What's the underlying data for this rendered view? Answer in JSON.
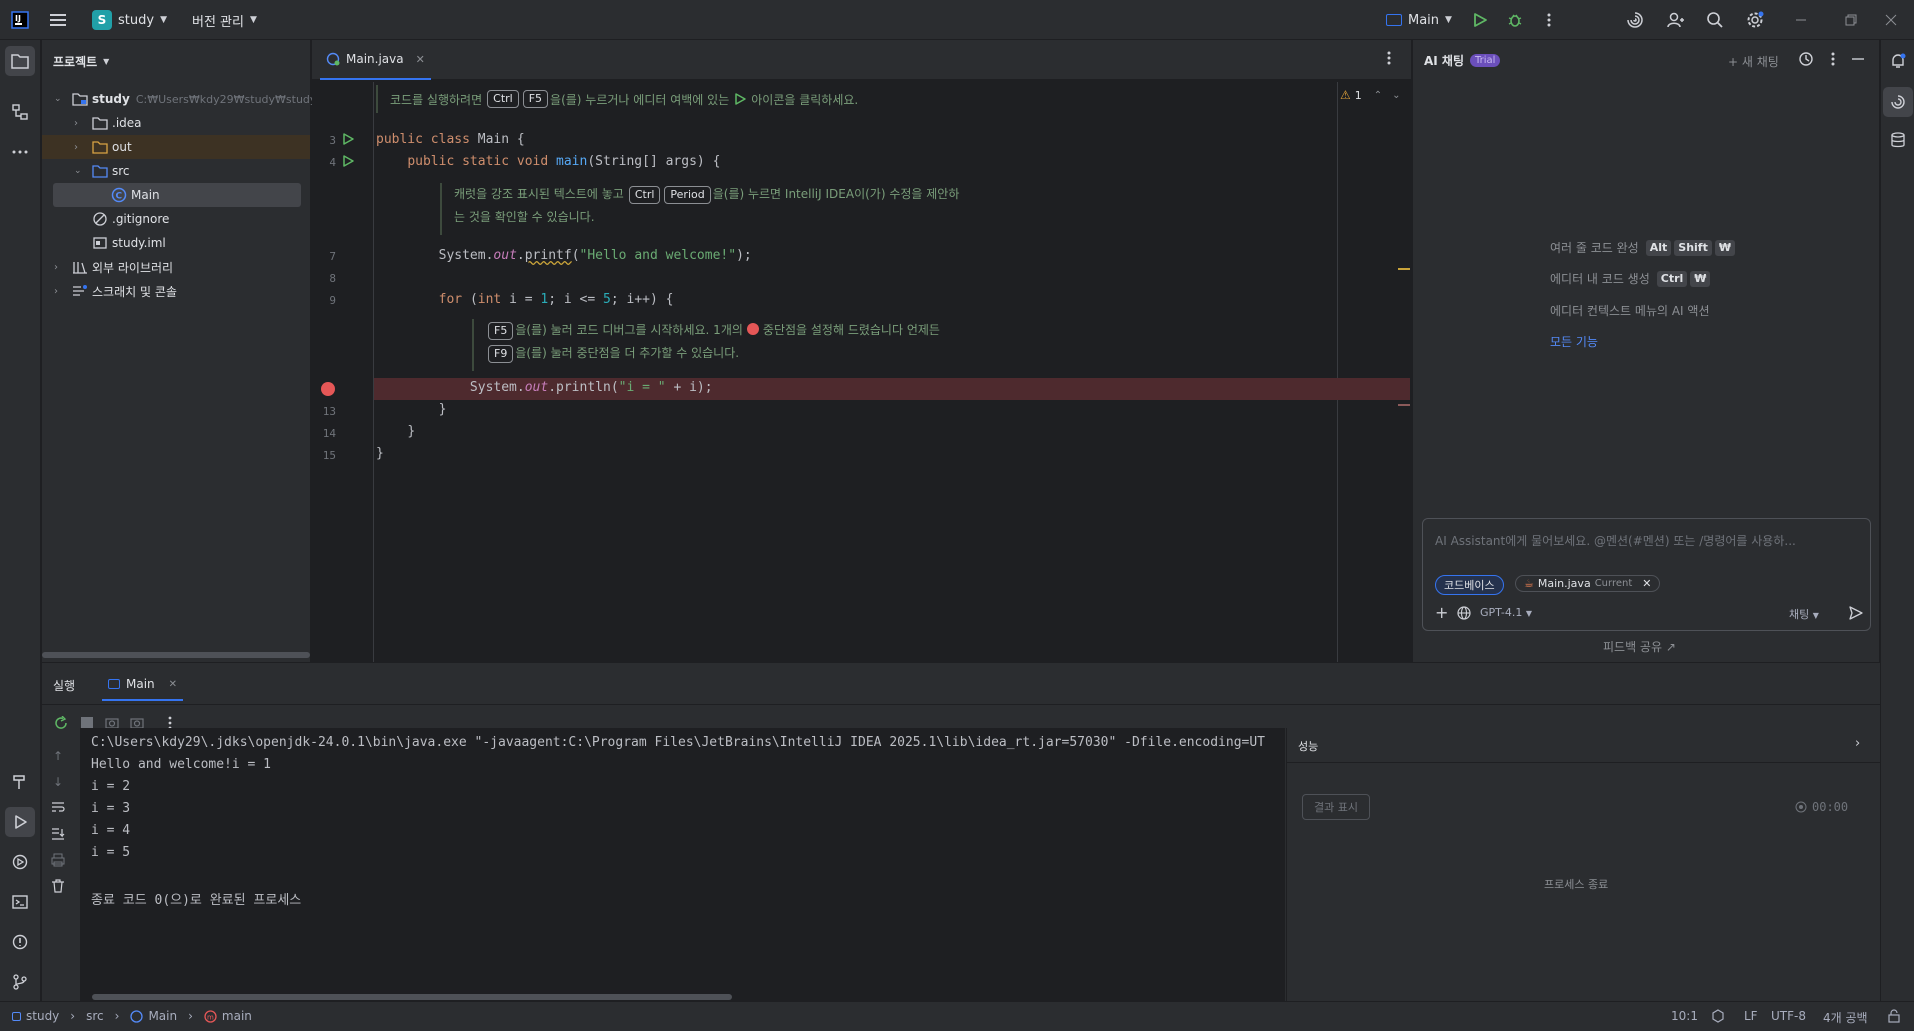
{
  "titlebar": {
    "project_letter": "S",
    "project_name": "study",
    "vcs_menu": "버전 관리",
    "run_config": "Main"
  },
  "project_panel": {
    "title": "프로젝트",
    "tree": {
      "root_name": "study",
      "root_path": "C:₩Users₩kdy29₩study₩study",
      "idea": ".idea",
      "out": "out",
      "src": "src",
      "main": "Main",
      "gitignore": ".gitignore",
      "iml": "study.iml",
      "ext_libs": "외부 라이브러리",
      "scratches": "스크래치 및 콘솔"
    }
  },
  "editor": {
    "tab_label": "Main.java",
    "warning_count": "1",
    "hint1_pre": "코드를 실행하려면",
    "hint1_k1": "Ctrl",
    "hint1_k2": "F5",
    "hint1_post": "을(를) 누르거나 에디터 여백에 있는",
    "hint1_end": "아이콘을 클릭하세요.",
    "hint2_pre": "캐럿을 강조 표시된 텍스트에 놓고",
    "hint2_k1": "Ctrl",
    "hint2_k2": "Period",
    "hint2_post": "을(를) 누르면 IntelliJ IDEA이(가) 수정을 제안하",
    "hint2_line2": "는 것을 확인할 수 있습니다.",
    "hint3_k1": "F5",
    "hint3_mid": "을(를) 눌러 코드 디버그를 시작하세요. 1개의",
    "hint3_end": "중단점을 설정해 드렸습니다 언제든",
    "hint3_k2": "F9",
    "hint3_line2": "을(를) 눌러 중단점을 더 추가할 수 있습니다.",
    "line_numbers": {
      "l3": "3",
      "l4": "4",
      "l7": "7",
      "l8": "8",
      "l9": "9",
      "l13": "13",
      "l14": "14",
      "l15": "15"
    },
    "code": {
      "l3_kw": "public class ",
      "l3_rest": "Main {",
      "l4_kw": "public static void ",
      "l4_fn": "main",
      "l4_rest": "(String[] args) {",
      "l7_a": "System.",
      "l7_fld": "out",
      "l7_b": ".",
      "l7_fn": "printf",
      "l7_c": "(",
      "l7_str": "\"Hello and welcome!\"",
      "l7_d": ");",
      "l9_kw": "for ",
      "l9_a": "(",
      "l9_kw2": "int ",
      "l9_b": "i = ",
      "l9_n1": "1",
      "l9_c": "; i <= ",
      "l9_n2": "5",
      "l9_d": "; i++) {",
      "l12_a": "System.",
      "l12_fld": "out",
      "l12_b": ".println(",
      "l12_str": "\"i = \"",
      "l12_c": " + i);",
      "l13": "}",
      "l14": "}",
      "l15": "}"
    }
  },
  "ai_panel": {
    "title": "AI 채팅",
    "trial_badge": "Trial",
    "new_chat": "+ 새 채팅",
    "feat1": "여러 줄 코드 완성",
    "feat1_keys": [
      "Alt",
      "Shift",
      "₩"
    ],
    "feat2": "에디터 내 코드 생성",
    "feat2_keys": [
      "Ctrl",
      "₩"
    ],
    "feat3": "에디터 컨텍스트 메뉴의 AI 액션",
    "all_features": "모든 기능",
    "input_placeholder": "AI Assistant에게 물어보세요. @멘션(#멘션) 또는 /명령어를 사용하...",
    "chip_codebase": "코드베이스",
    "chip_file": "Main.java",
    "chip_current": "Current",
    "model": "GPT-4.1",
    "mode": "채팅",
    "feedback": "피드백 공유 ↗"
  },
  "run_panel": {
    "tab_run": "실행",
    "tab_main": "Main",
    "console": [
      "C:\\Users\\kdy29\\.jdks\\openjdk-24.0.1\\bin\\java.exe \"-javaagent:C:\\Program Files\\JetBrains\\IntelliJ IDEA 2025.1\\lib\\idea_rt.jar=57030\" -Dfile.encoding=UT",
      "Hello and welcome!i = 1",
      "i = 2",
      "i = 3",
      "i = 4",
      "i = 5",
      "",
      "종료 코드 0(으)로 완료된 프로세스"
    ],
    "perf_title": "성능",
    "show_results": "결과 표시",
    "timer": "00:00",
    "process_ended": "프로세스 종료"
  },
  "statusbar": {
    "crumb_project": "study",
    "crumb_src": "src",
    "crumb_class": "Main",
    "crumb_method": "main",
    "position": "10:1",
    "line_sep": "LF",
    "encoding": "UTF-8",
    "indent": "4개 공백"
  },
  "colors": {
    "accent": "#3574f0",
    "run_green": "#5fb865",
    "breakpoint": "#e55757",
    "breakpoint_line": "#4e2a2e",
    "project_badge": "#21a0a8"
  }
}
